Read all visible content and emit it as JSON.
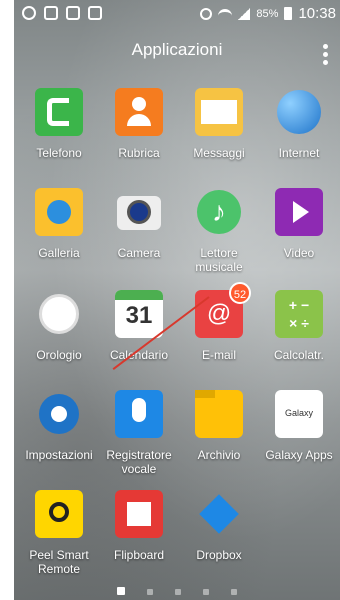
{
  "status_bar": {
    "battery_percent": "85%",
    "time": "10:38"
  },
  "header": {
    "title": "Applicazioni"
  },
  "apps": [
    {
      "id": "telefono",
      "label": "Telefono"
    },
    {
      "id": "rubrica",
      "label": "Rubrica"
    },
    {
      "id": "messaggi",
      "label": "Messaggi"
    },
    {
      "id": "internet",
      "label": "Internet"
    },
    {
      "id": "galleria",
      "label": "Galleria"
    },
    {
      "id": "camera",
      "label": "Camera"
    },
    {
      "id": "lettore",
      "label": "Lettore\nmusicale"
    },
    {
      "id": "video",
      "label": "Video"
    },
    {
      "id": "orologio",
      "label": "Orologio"
    },
    {
      "id": "calendario",
      "label": "Calendario",
      "date_number": "31"
    },
    {
      "id": "email",
      "label": "E-mail",
      "badge": "52"
    },
    {
      "id": "calcolatrice",
      "label": "Calcolatr."
    },
    {
      "id": "impostazioni",
      "label": "Impostazioni"
    },
    {
      "id": "registratore",
      "label": "Registratore\nvocale"
    },
    {
      "id": "archivio",
      "label": "Archivio"
    },
    {
      "id": "galaxy",
      "label": "Galaxy Apps",
      "icon_text": "Galaxy"
    },
    {
      "id": "peel",
      "label": "Peel Smart\nRemote"
    },
    {
      "id": "flipboard",
      "label": "Flipboard"
    },
    {
      "id": "dropbox",
      "label": "Dropbox"
    }
  ],
  "page_indicator": {
    "pages": 5,
    "active": 1
  }
}
